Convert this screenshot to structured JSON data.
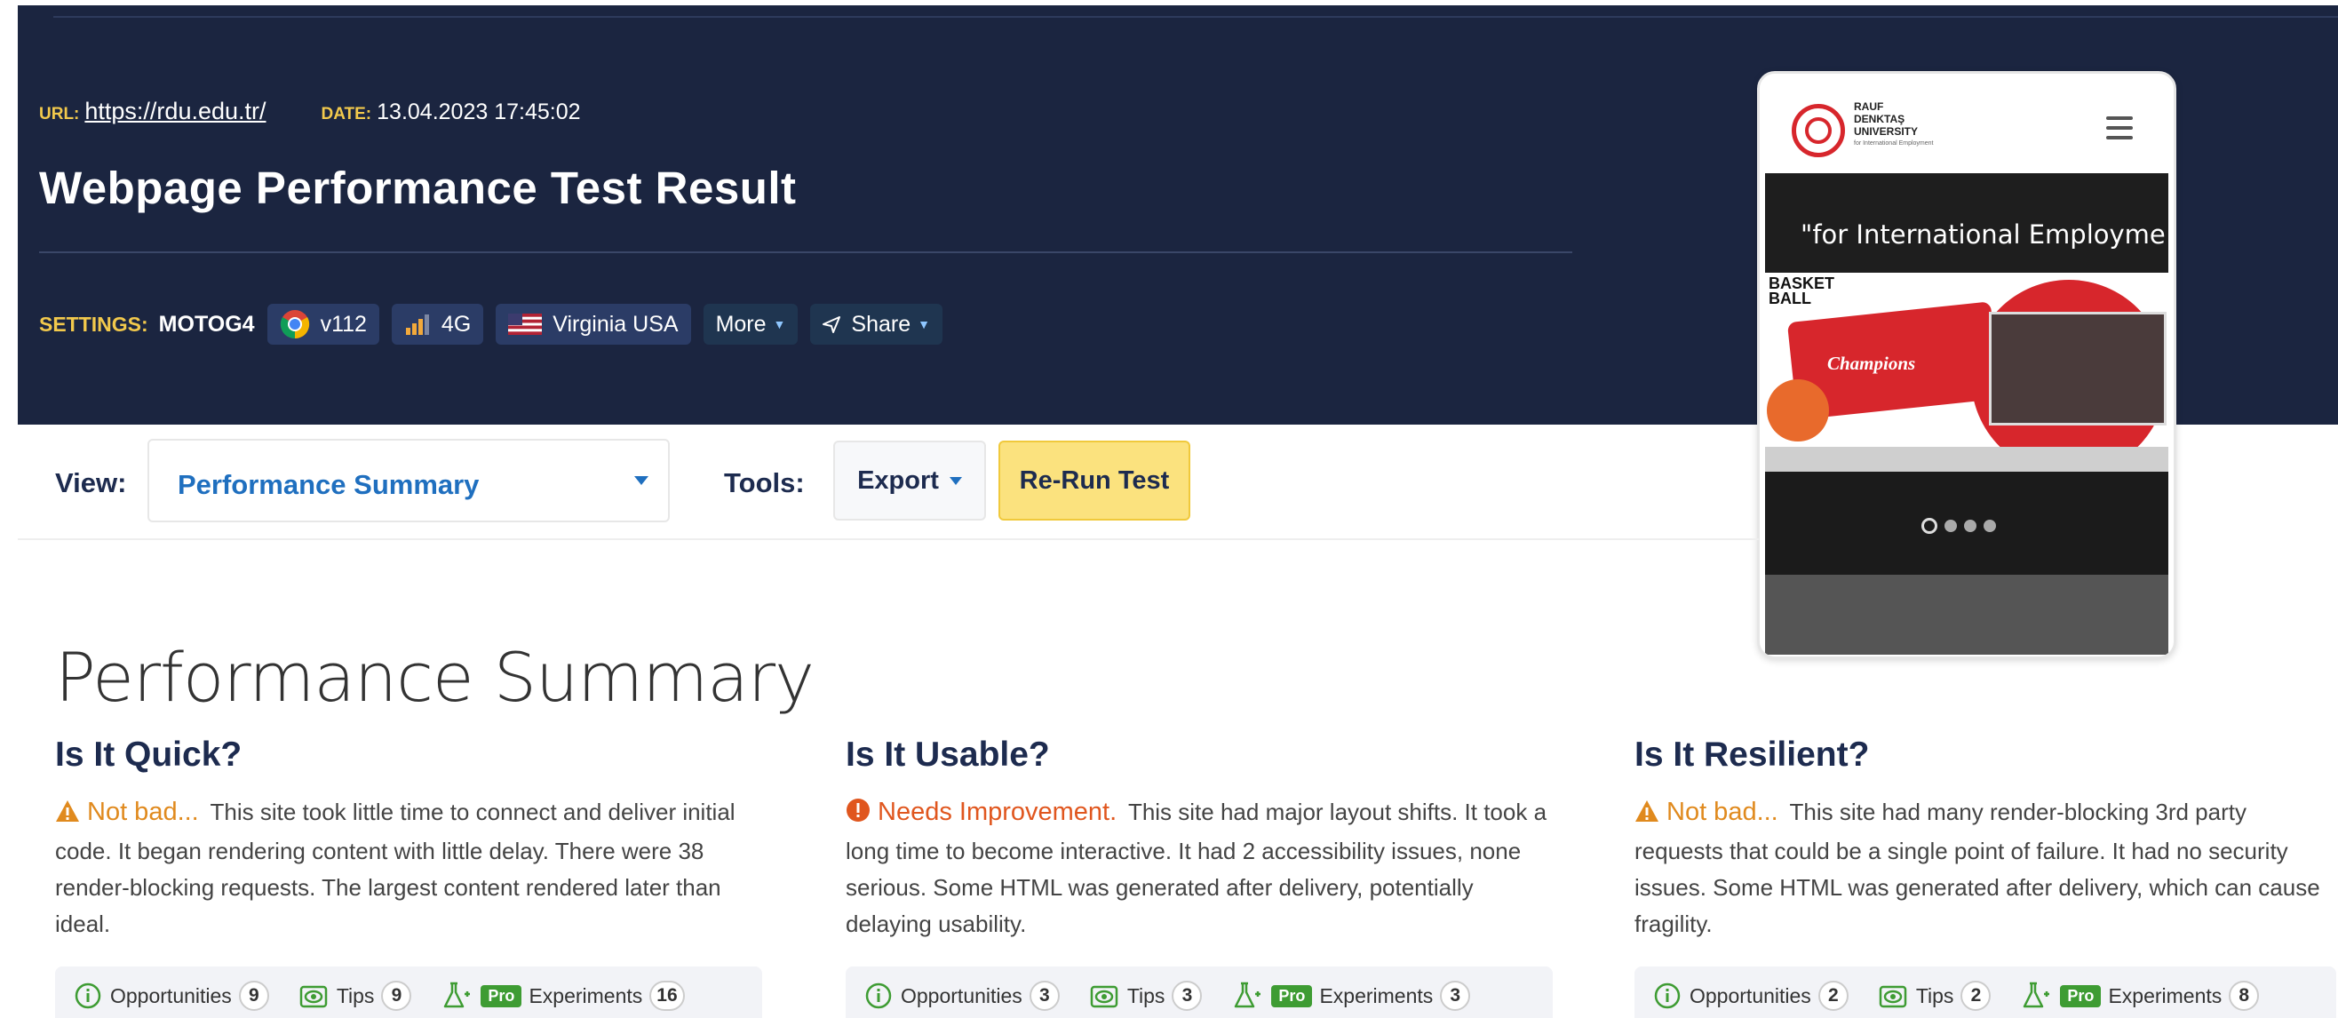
{
  "header": {
    "url_label": "URL:",
    "url": "https://rdu.edu.tr/",
    "date_label": "DATE:",
    "date": "13.04.2023 17:45:02",
    "title": "Webpage Performance Test Result",
    "settings_label": "SETTINGS:",
    "device": "MOTOG4",
    "browser": "v112",
    "network": "4G",
    "location": "Virginia USA",
    "more_label": "More",
    "share_label": "Share"
  },
  "preview": {
    "brand_line1": "RAUF",
    "brand_line2": "DENKTAŞ",
    "brand_line3": "UNIVERSITY",
    "brand_sub": "for International Employment",
    "tagline": "\"for International Employme",
    "banner_title_1": "BASKET",
    "banner_title_2": "BALL",
    "banner_champ": "Champions"
  },
  "toolbar": {
    "view_label": "View:",
    "view_value": "Performance Summary",
    "tools_label": "Tools:",
    "export_label": "Export",
    "rerun_label": "Re-Run Test"
  },
  "summary": {
    "title": "Performance Summary",
    "columns": [
      {
        "heading": "Is It Quick?",
        "verdict": "Not bad...",
        "text": "This site took little time to connect and deliver initial code. It began rendering content with little delay. There were 38 render-blocking requests. The largest content rendered later than ideal.",
        "opportunities_label": "Opportunities",
        "opportunities": "9",
        "tips_label": "Tips",
        "tips": "9",
        "pro_label": "Pro",
        "experiments_label": "Experiments",
        "experiments": "16"
      },
      {
        "heading": "Is It Usable?",
        "verdict": "Needs Improvement.",
        "text": "This site had major layout shifts. It took a long time to become interactive. It had 2 accessibility issues, none serious. Some HTML was generated after delivery, potentially delaying usability.",
        "opportunities_label": "Opportunities",
        "opportunities": "3",
        "tips_label": "Tips",
        "tips": "3",
        "pro_label": "Pro",
        "experiments_label": "Experiments",
        "experiments": "3"
      },
      {
        "heading": "Is It Resilient?",
        "verdict": "Not bad...",
        "text": "This site had many render-blocking 3rd party requests that could be a single point of failure. It had no security issues. Some HTML was generated after delivery, which can cause fragility.",
        "opportunities_label": "Opportunities",
        "opportunities": "2",
        "tips_label": "Tips",
        "tips": "2",
        "pro_label": "Pro",
        "experiments_label": "Experiments",
        "experiments": "8"
      }
    ]
  },
  "colors": {
    "header_bg": "#1b2540",
    "label_gold": "#f2c94c",
    "link_blue": "#1f6fbf",
    "warn": "#e08a1e",
    "bad": "#e0561e",
    "rerun_yellow": "#fbe27e",
    "pro_green": "#3e9c33"
  },
  "icons": {
    "browser": "chrome-icon",
    "network": "signal-bars-icon",
    "location": "us-flag-icon",
    "share": "paper-plane-icon",
    "quick_status": "warning-triangle-icon",
    "usable_status": "error-circle-icon",
    "resilient_status": "warning-triangle-icon",
    "opportunities": "info-circle-icon",
    "tips": "eye-icon",
    "experiments": "flask-icon"
  }
}
